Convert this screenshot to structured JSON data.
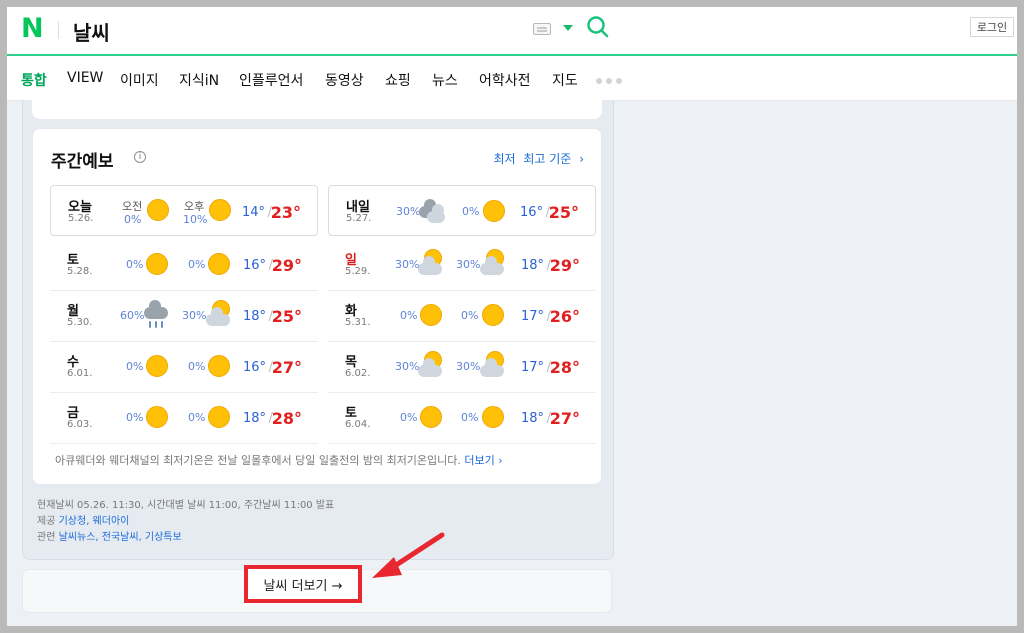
{
  "header": {
    "logo": "N",
    "title": "날씨",
    "login": "로그인"
  },
  "nav": {
    "items": [
      "통합",
      "VIEW",
      "이미지",
      "지식iN",
      "인플루언서",
      "동영상",
      "쇼핑",
      "뉴스",
      "어학사전",
      "지도"
    ],
    "active_index": 0
  },
  "weekly": {
    "title": "주간예보",
    "tab_low": "최저",
    "tab_high": "최고 기준",
    "days": [
      {
        "name": "오늘",
        "date": "5.26.",
        "am_label": "오전",
        "pm_label": "오후",
        "am_pct": "0%",
        "pm_pct": "10%",
        "am_icon": "sun-icon",
        "pm_icon": "sun-icon",
        "lo": "14°",
        "hi": "23°"
      },
      {
        "name": "내일",
        "date": "5.27.",
        "am_pct": "30%",
        "pm_pct": "0%",
        "am_icon": "cloudy-icon",
        "pm_icon": "sun-icon",
        "lo": "16°",
        "hi": "25°"
      },
      {
        "name": "토",
        "date": "5.28.",
        "am_pct": "0%",
        "pm_pct": "0%",
        "am_icon": "sun-icon",
        "pm_icon": "sun-icon",
        "lo": "16°",
        "hi": "29°"
      },
      {
        "name": "일",
        "date": "5.29.",
        "am_pct": "30%",
        "pm_pct": "30%",
        "am_icon": "partly-cloudy-icon",
        "pm_icon": "partly-cloudy-icon",
        "lo": "18°",
        "hi": "29°",
        "red": true
      },
      {
        "name": "월",
        "date": "5.30.",
        "am_pct": "60%",
        "pm_pct": "30%",
        "am_icon": "rain-icon",
        "pm_icon": "partly-cloudy-icon",
        "lo": "18°",
        "hi": "25°"
      },
      {
        "name": "화",
        "date": "5.31.",
        "am_pct": "0%",
        "pm_pct": "0%",
        "am_icon": "sun-icon",
        "pm_icon": "sun-icon",
        "lo": "17°",
        "hi": "26°"
      },
      {
        "name": "수",
        "date": "6.01.",
        "am_pct": "0%",
        "pm_pct": "0%",
        "am_icon": "sun-icon",
        "pm_icon": "sun-icon",
        "lo": "16°",
        "hi": "27°"
      },
      {
        "name": "목",
        "date": "6.02.",
        "am_pct": "30%",
        "pm_pct": "30%",
        "am_icon": "partly-cloudy-icon",
        "pm_icon": "partly-cloudy-icon",
        "lo": "17°",
        "hi": "28°"
      },
      {
        "name": "금",
        "date": "6.03.",
        "am_pct": "0%",
        "pm_pct": "0%",
        "am_icon": "sun-icon",
        "pm_icon": "sun-icon",
        "lo": "18°",
        "hi": "28°"
      },
      {
        "name": "토",
        "date": "6.04.",
        "am_pct": "0%",
        "pm_pct": "0%",
        "am_icon": "sun-icon",
        "pm_icon": "sun-icon",
        "lo": "18°",
        "hi": "27°"
      }
    ],
    "note": "아큐웨더와 웨더채널의 최저기온은 전날 일몰후에서 당일 일출전의 밤의 최저기온입니다.",
    "note_more": "더보기"
  },
  "meta": {
    "line1": "현재날씨 05.26. 11:30, 시간대별 날씨 11:00, 주간날씨 11:00 발표",
    "provider_label": "제공",
    "providers": "기상청, 웨더아이",
    "related_label": "관련",
    "related": "날씨뉴스, 전국날씨, 기상특보"
  },
  "more_button": "날씨 더보기 →"
}
